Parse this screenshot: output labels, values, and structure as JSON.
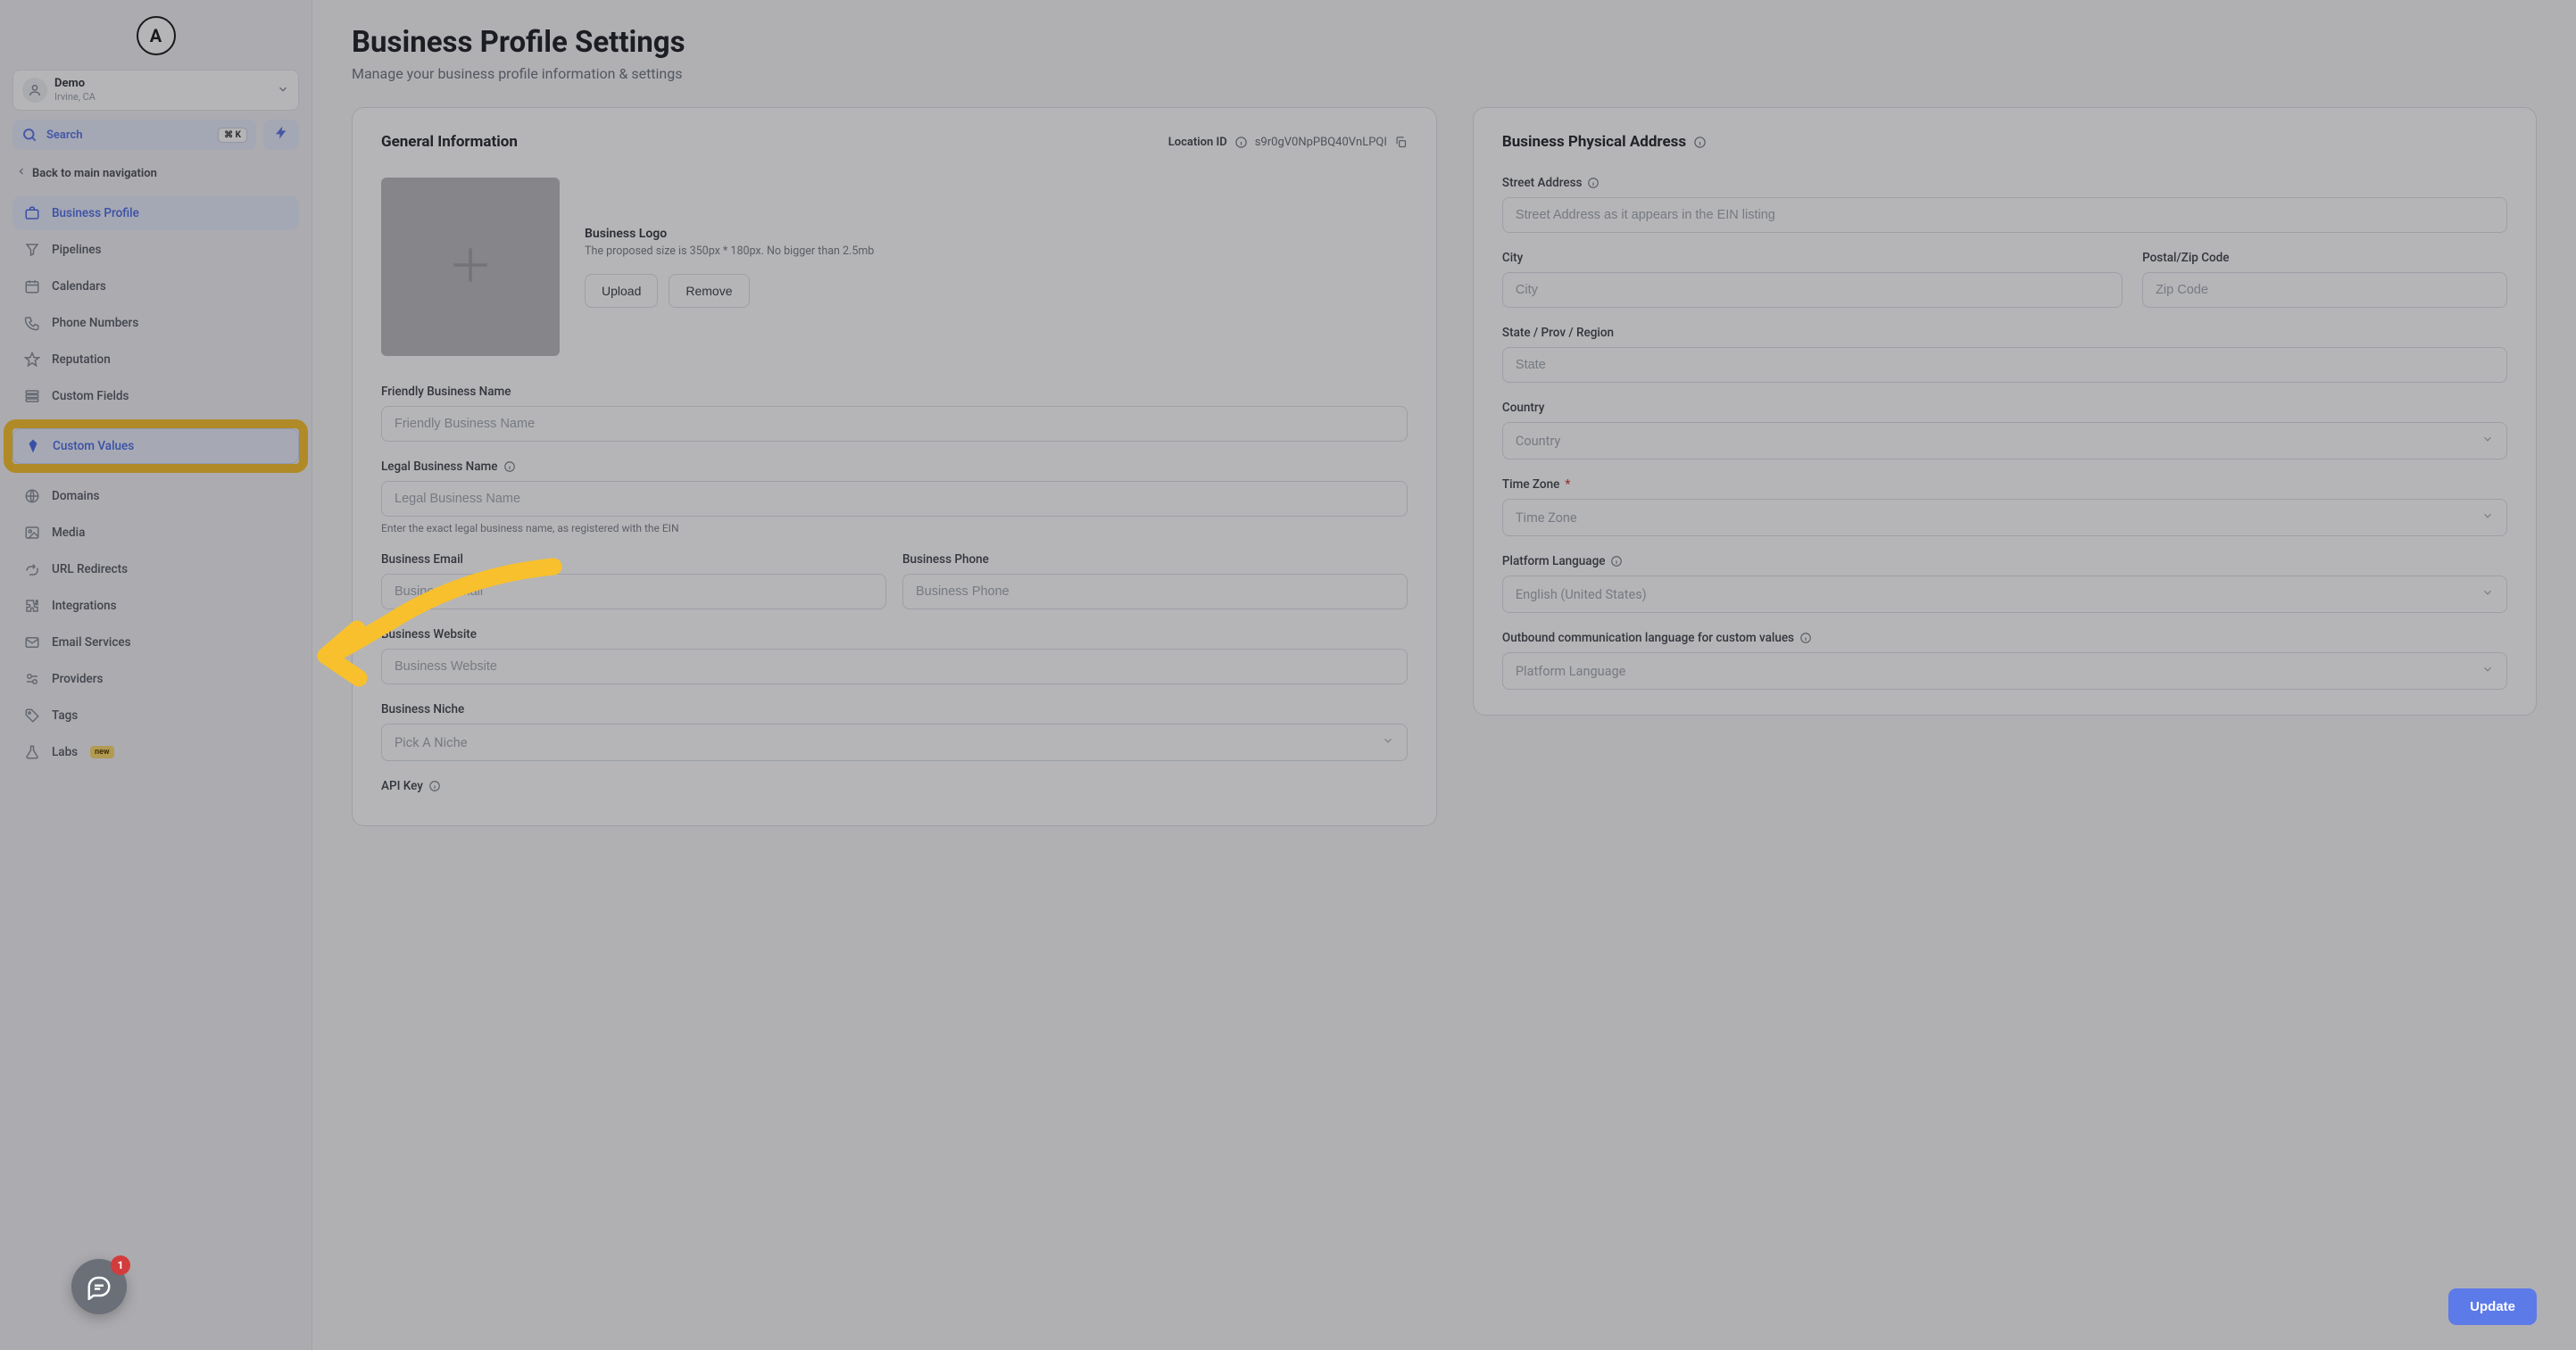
{
  "brand": {
    "logo_letter": "A"
  },
  "location": {
    "title": "Demo",
    "subtitle": "Irvine, CA"
  },
  "search": {
    "label": "Search",
    "kbd": "⌘ K"
  },
  "back_nav": {
    "label": "Back to main navigation"
  },
  "sidebar": {
    "items": [
      {
        "label": "Business Profile",
        "icon": "briefcase",
        "active": true
      },
      {
        "label": "Pipelines",
        "icon": "funnel"
      },
      {
        "label": "Calendars",
        "icon": "calendar"
      },
      {
        "label": "Phone Numbers",
        "icon": "phone"
      },
      {
        "label": "Reputation",
        "icon": "star"
      },
      {
        "label": "Custom Fields",
        "icon": "fields"
      },
      {
        "label": "Custom Values",
        "icon": "diamond",
        "highlight": true
      },
      {
        "label": "Domains",
        "icon": "globe"
      },
      {
        "label": "Media",
        "icon": "image"
      },
      {
        "label": "URL Redirects",
        "icon": "redirect"
      },
      {
        "label": "Integrations",
        "icon": "puzzle"
      },
      {
        "label": "Email Services",
        "icon": "mail"
      },
      {
        "label": "Providers",
        "icon": "providers"
      },
      {
        "label": "Tags",
        "icon": "tag"
      },
      {
        "label": "Labs",
        "icon": "flask",
        "badge": "new"
      }
    ]
  },
  "page": {
    "title": "Business Profile Settings",
    "subtitle": "Manage your business profile information & settings"
  },
  "general": {
    "title": "General Information",
    "location_id_label": "Location ID",
    "location_id_value": "s9r0gV0NpPBQ40VnLPQI",
    "logo": {
      "title": "Business Logo",
      "hint": "The proposed size is 350px * 180px. No bigger than 2.5mb",
      "upload": "Upload",
      "remove": "Remove"
    },
    "friendly_name": {
      "label": "Friendly Business Name",
      "placeholder": "Friendly Business Name"
    },
    "legal_name": {
      "label": "Legal Business Name",
      "placeholder": "Legal Business Name",
      "hint": "Enter the exact legal business name, as registered with the EIN"
    },
    "email": {
      "label": "Business Email",
      "placeholder": "Business Email"
    },
    "phone": {
      "label": "Business Phone",
      "placeholder": "Business Phone"
    },
    "website": {
      "label": "Business Website",
      "placeholder": "Business Website"
    },
    "niche": {
      "label": "Business Niche",
      "placeholder": "Pick A Niche"
    },
    "api_key": {
      "label": "API Key"
    }
  },
  "address": {
    "title": "Business Physical Address",
    "street": {
      "label": "Street Address",
      "placeholder": "Street Address as it appears in the EIN listing"
    },
    "city": {
      "label": "City",
      "placeholder": "City"
    },
    "zip": {
      "label": "Postal/Zip Code",
      "placeholder": "Zip Code"
    },
    "state": {
      "label": "State / Prov / Region",
      "placeholder": "State"
    },
    "country": {
      "label": "Country",
      "placeholder": "Country"
    },
    "tz": {
      "label": "Time Zone",
      "placeholder": "Time Zone"
    },
    "lang": {
      "label": "Platform Language",
      "placeholder": "English (United States)"
    },
    "outbound": {
      "label": "Outbound communication language for custom values",
      "placeholder": "Platform Language"
    }
  },
  "actions": {
    "update": "Update"
  },
  "chat": {
    "badge": "1"
  }
}
